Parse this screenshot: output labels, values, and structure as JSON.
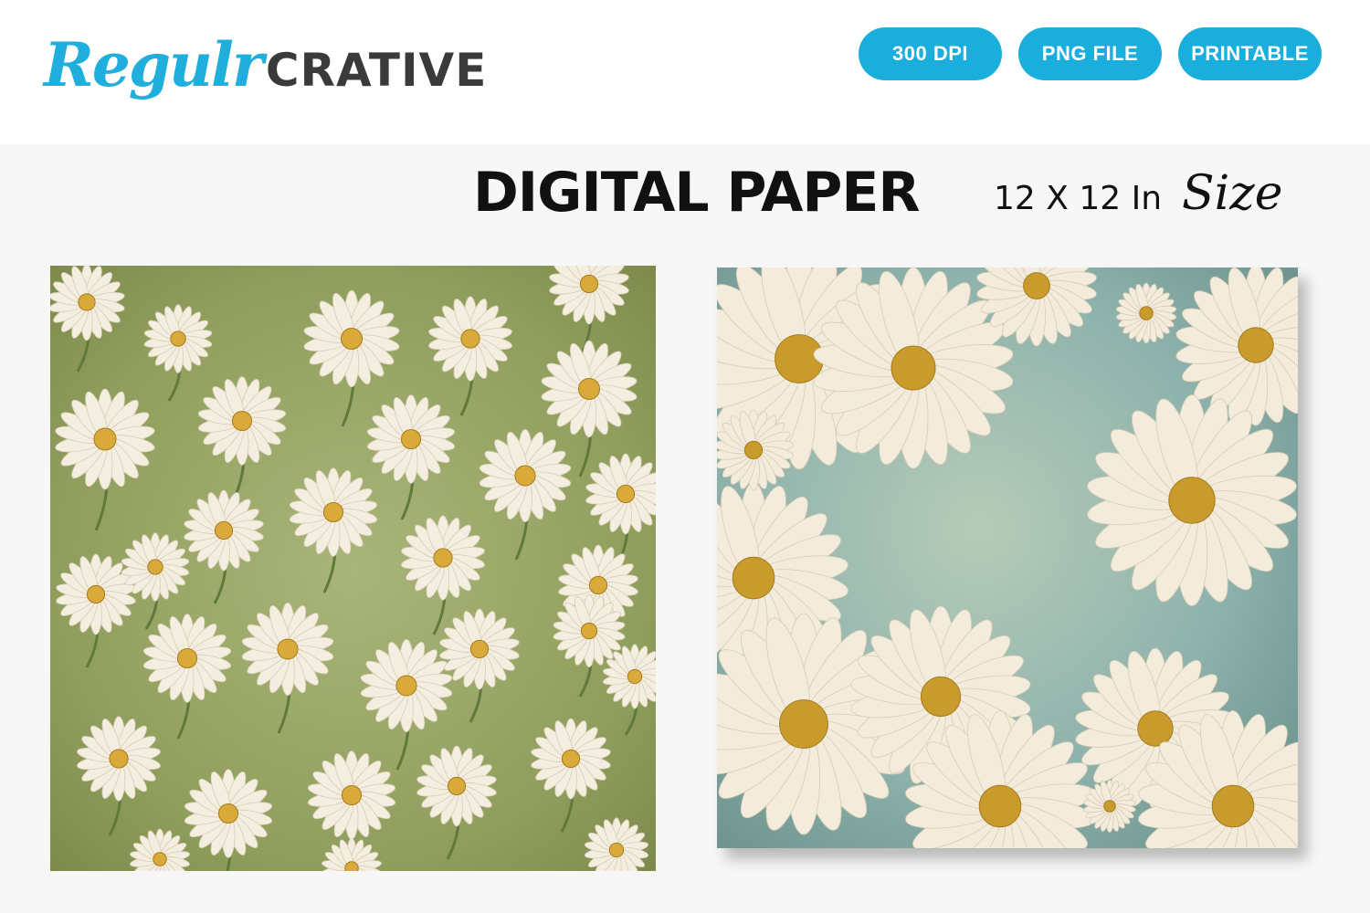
{
  "brand": {
    "script": "Regulr",
    "block": "CRATIVE"
  },
  "badges": [
    "300 DPI",
    "PNG FILE",
    "PRINTABLE"
  ],
  "headline": "DIGITAL PAPER",
  "size": {
    "text": "12 X 12 In",
    "script": "Size"
  },
  "colors": {
    "accent": "#1aaedd",
    "left_paper_bg": "#9aa86a",
    "right_paper_bg": "#8fb3ad",
    "petal": "#f6f0e2",
    "center": "#d2a52c"
  }
}
